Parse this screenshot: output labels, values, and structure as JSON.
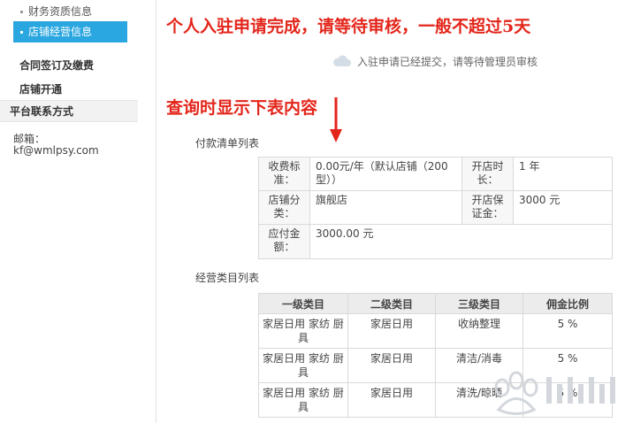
{
  "sidebar": {
    "sub_items": [
      {
        "label": "财务资质信息",
        "active": false
      },
      {
        "label": "店铺经营信息",
        "active": true
      }
    ],
    "heads": [
      "合同签订及缴费",
      "店铺开通"
    ],
    "section_title": "平台联系方式",
    "contact_label": "邮箱：",
    "contact_value": "kf@wmlpsy.com"
  },
  "annotations": {
    "heading1": "个人入驻申请完成，请等待审核，一般不超过5天",
    "heading2": "查询时显示下表内容"
  },
  "notice": {
    "icon": "cloud-icon",
    "text": "入驻申请已经提交，请等待管理员审核"
  },
  "payment": {
    "section_label": "付款清单列表",
    "fee_label": "收费标准：",
    "fee_value": "0.00元/年（默认店铺（200型））",
    "duration_label": "开店时长：",
    "duration_value": "1 年",
    "category_label": "店铺分类：",
    "category_value": "旗舰店",
    "deposit_label": "开店保证金：",
    "deposit_value": "3000 元",
    "payable_label": "应付金额：",
    "payable_value": "3000.00 元"
  },
  "categories": {
    "section_label": "经营类目列表",
    "headers": [
      "一级类目",
      "二级类目",
      "三级类目",
      "佣金比例"
    ],
    "rows": [
      [
        "家居日用 家纺 厨具",
        "家居日用",
        "收纳整理",
        "5 %"
      ],
      [
        "家居日用 家纺 厨具",
        "家居日用",
        "清洁/消毒",
        "5 %"
      ],
      [
        "家居日用 家纺 厨具",
        "家居日用",
        "清洗/晾晒",
        "5 %"
      ]
    ]
  },
  "watermark": {
    "icon": "baidu-jingyan-watermark-icon"
  },
  "colors": {
    "accent": "#2aa7e0",
    "annotation_red": "#e3261b"
  }
}
